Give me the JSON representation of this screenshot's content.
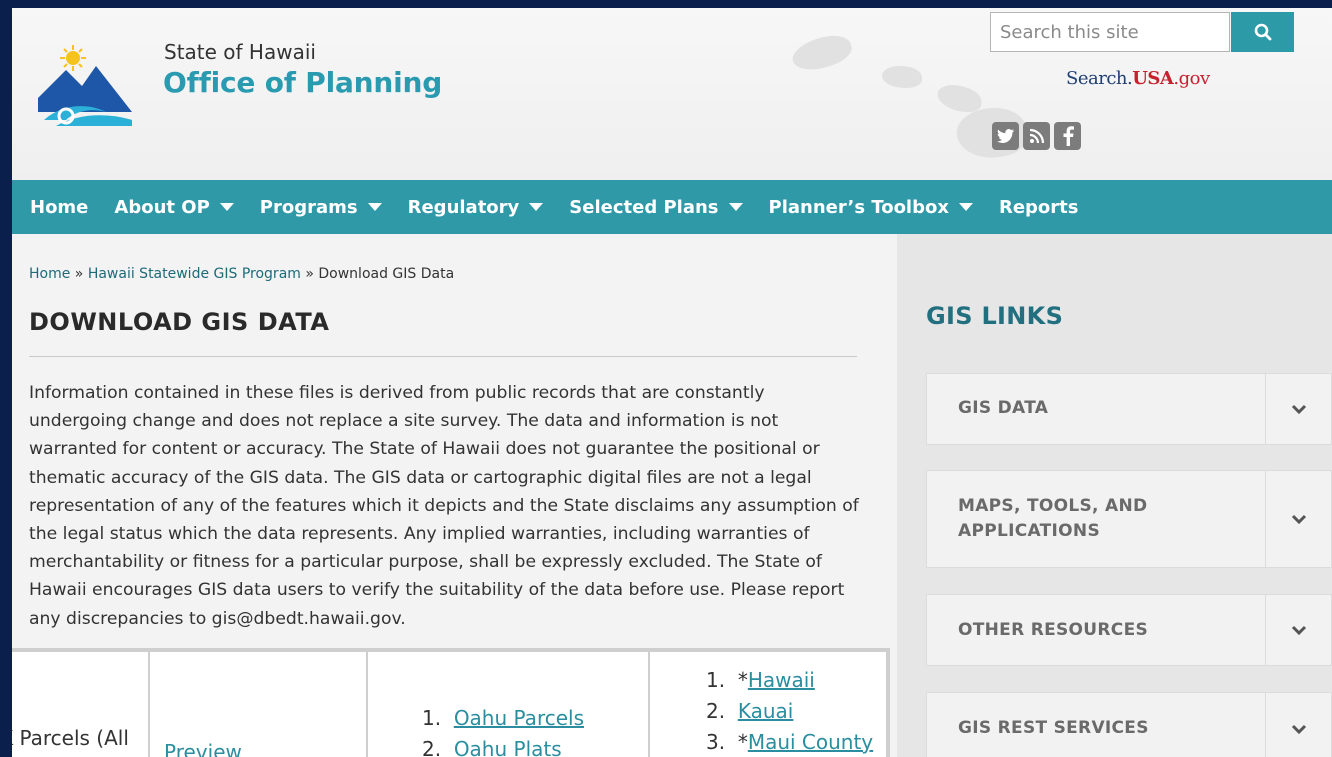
{
  "header": {
    "site_subtitle": "State of Hawaii",
    "site_title": "Office of Planning",
    "search_placeholder": "Search this site",
    "usagov_prefix": "Search.",
    "usagov_usa": "USA",
    "usagov_suffix": ".gov",
    "social": [
      "twitter-icon",
      "rss-icon",
      "facebook-icon"
    ]
  },
  "nav": {
    "items": [
      {
        "label": "Home",
        "dropdown": false
      },
      {
        "label": "About OP",
        "dropdown": true
      },
      {
        "label": "Programs",
        "dropdown": true
      },
      {
        "label": "Regulatory",
        "dropdown": true
      },
      {
        "label": "Selected Plans",
        "dropdown": true
      },
      {
        "label": "Planner’s Toolbox",
        "dropdown": true
      },
      {
        "label": "Reports",
        "dropdown": false
      }
    ]
  },
  "breadcrumb": {
    "home": "Home",
    "sep1": " » ",
    "program": "Hawaii Statewide GIS Program",
    "sep2": " » ",
    "current": "Download GIS Data"
  },
  "main": {
    "title": "DOWNLOAD GIS DATA",
    "disclaimer": "Information contained in these files is derived from public records that are constantly undergoing change and does not replace a site survey. The data and information is not warranted for content or accuracy. The State of Hawaii does not guarantee the positional or thematic accuracy of the GIS data. The GIS data or cartographic digital files are not a legal representation of any of the features which it depicts and the State disclaims any assumption of the legal status which the data represents. Any implied warranties, including warranties of merchantability or fitness for a particular purpose, shall be expressly excluded. The State of Hawaii encourages GIS data users to verify the suitability of the data before use. Please report any discrepancies to gis@dbedt.hawaii.gov."
  },
  "table": {
    "col1_text": "K Parcels (All",
    "col2_text": "Preview",
    "col3_items": [
      {
        "num": "1.",
        "label": "Oahu Parcels"
      },
      {
        "num": "2.",
        "label": "Oahu Plats"
      }
    ],
    "col4_items": [
      {
        "num": "1.",
        "prefix": "*",
        "label": "Hawaii"
      },
      {
        "num": "2.",
        "prefix": "",
        "label": "Kauai"
      },
      {
        "num": "3.",
        "prefix": "*",
        "label": "Maui County"
      }
    ]
  },
  "sidebar": {
    "title": "GIS LINKS",
    "items": [
      {
        "label": "GIS DATA"
      },
      {
        "label": "MAPS, TOOLS, AND APPLICATIONS"
      },
      {
        "label": "OTHER RESOURCES"
      },
      {
        "label": "GIS REST SERVICES"
      }
    ]
  }
}
